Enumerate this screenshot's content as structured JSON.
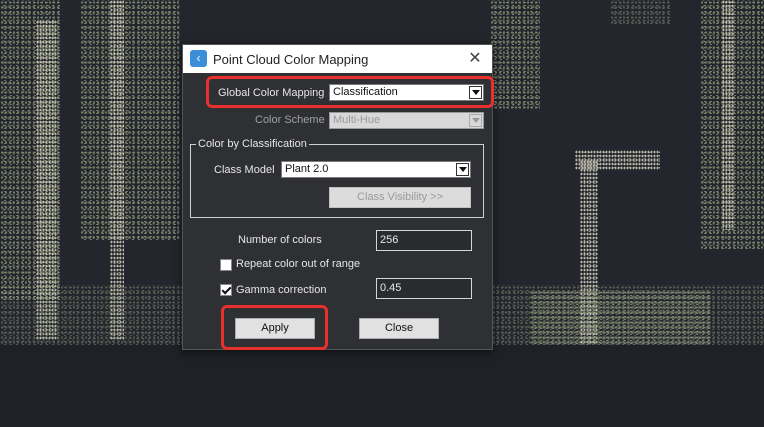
{
  "dialog": {
    "title": "Point Cloud Color Mapping",
    "icon": "app-icon",
    "close_glyph": "✕"
  },
  "global_color_mapping": {
    "label": "Global Color Mapping",
    "value": "Classification"
  },
  "color_scheme": {
    "label": "Color Scheme",
    "value": "Multi-Hue"
  },
  "color_by_classification": {
    "group_label": "Color by Classification",
    "class_model_label": "Class Model",
    "class_model_value": "Plant 2.0",
    "class_visibility_label": "Class Visibility >>"
  },
  "number_of_colors": {
    "label": "Number of colors",
    "value": "256"
  },
  "repeat_color": {
    "label": "Repeat color out of range",
    "checked": false
  },
  "gamma_correction": {
    "label": "Gamma correction",
    "checked": true,
    "value": "0.45"
  },
  "buttons": {
    "apply": "Apply",
    "close": "Close"
  },
  "colors": {
    "highlight": "#e8302e",
    "dialog_bg": "#2f3033",
    "accent": "#3a8fd8"
  }
}
